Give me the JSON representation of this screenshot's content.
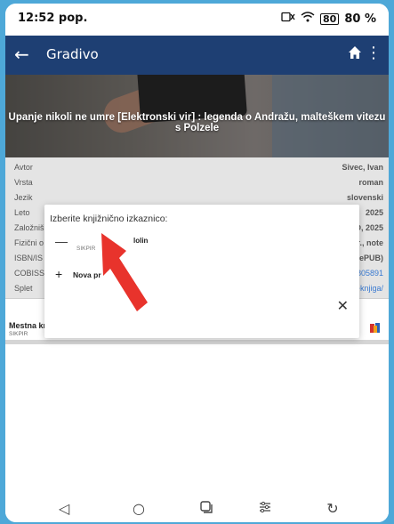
{
  "status": {
    "time": "12:52 pop.",
    "battery": "80 %",
    "battery_icon_label": "80"
  },
  "appbar": {
    "title": "Gradivo"
  },
  "hero": {
    "title": "Upanje nikoli ne umre [Elektronski vir] : legenda o Andražu, malteškem vitezu s Polzele"
  },
  "details": {
    "rows": [
      {
        "key": "Avtor",
        "value": "Sivec, Ivan"
      },
      {
        "key": "Vrsta",
        "value": "roman"
      },
      {
        "key": "Jezik",
        "value": "slovenski"
      },
      {
        "key": "Leto",
        "value": "2025"
      },
      {
        "key": "Založniš",
        "value": "CO, 2025"
      },
      {
        "key": "Fizični o",
        "value": "str., note"
      },
      {
        "key": "ISBN/IS",
        "value": "0 (ePUB)"
      },
      {
        "key": "COBISS.",
        "value": "805891"
      },
      {
        "key": "Splet",
        "value": "~knjiga/"
      }
    ]
  },
  "library": {
    "name": "Mestna kr",
    "sub": "SIKPIR"
  },
  "dialog": {
    "title": "Izberite knjižnično izkaznico:",
    "option1_name": "lolin",
    "option1_sub": "SIKPIR",
    "option2_label": "Nova pr"
  },
  "colors": {
    "appbar": "#1e3f73",
    "accent_link": "#3a7ad1",
    "arrow": "#e8332c"
  }
}
